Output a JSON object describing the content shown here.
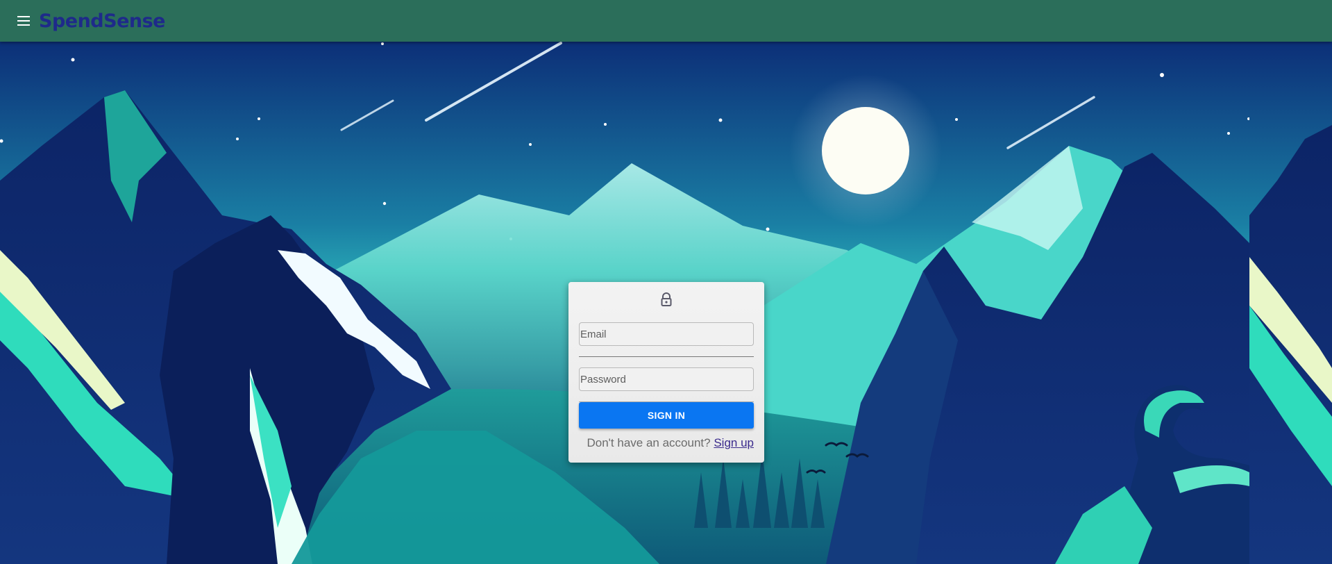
{
  "appbar": {
    "brand": "SpendSense",
    "background_color": "#2b6e5a",
    "brand_color": "#1e2a8a",
    "menu_icon": "hamburger-menu-icon"
  },
  "login": {
    "lock_icon": "lock-icon",
    "email_placeholder": "Email",
    "email_value": "",
    "password_placeholder": "Password",
    "password_value": "",
    "signin_label": "SIGN IN",
    "signin_color": "#0a76f2",
    "no_account_text": "Don't have an account?",
    "signup_link": "Sign up"
  }
}
